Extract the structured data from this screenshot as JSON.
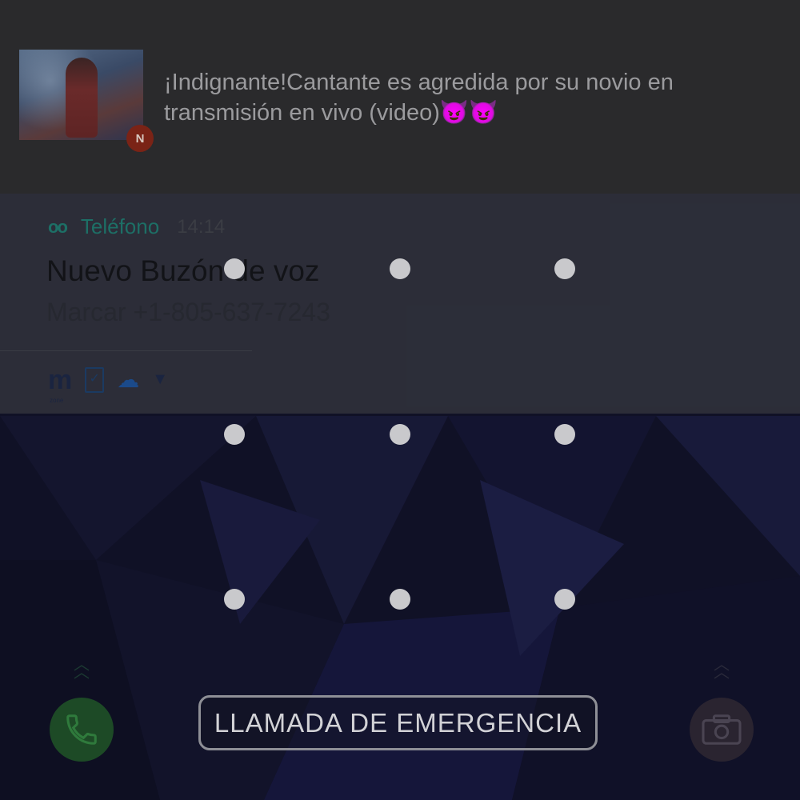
{
  "news_notification": {
    "text": "¡Indignante!Cantante es agredida por su novio en transmisión en vivo (video)",
    "emoji": "😈😈",
    "badge_icon": "news-app-badge-icon"
  },
  "phone_notification": {
    "app_icon": "voicemail-icon",
    "app_name": "Teléfono",
    "time": "14:14",
    "title": "Nuevo Buzón de voz",
    "subtitle": "Marcar +1-805-637-7243",
    "status_icons": [
      "m-zone-icon",
      "checklist-icon",
      "cloud-icon",
      "chevron-down-icon"
    ],
    "m_zone_label": "zone"
  },
  "lock": {
    "pattern_dots": 9,
    "emergency_label": "LLAMADA DE EMERGENCIA",
    "left_shortcut_icon": "phone-icon",
    "right_shortcut_icon": "camera-icon"
  },
  "colors": {
    "phone_app_accent": "#1d6f66",
    "phone_shortcut": "#1d4a26",
    "news_badge": "#7a2316"
  }
}
